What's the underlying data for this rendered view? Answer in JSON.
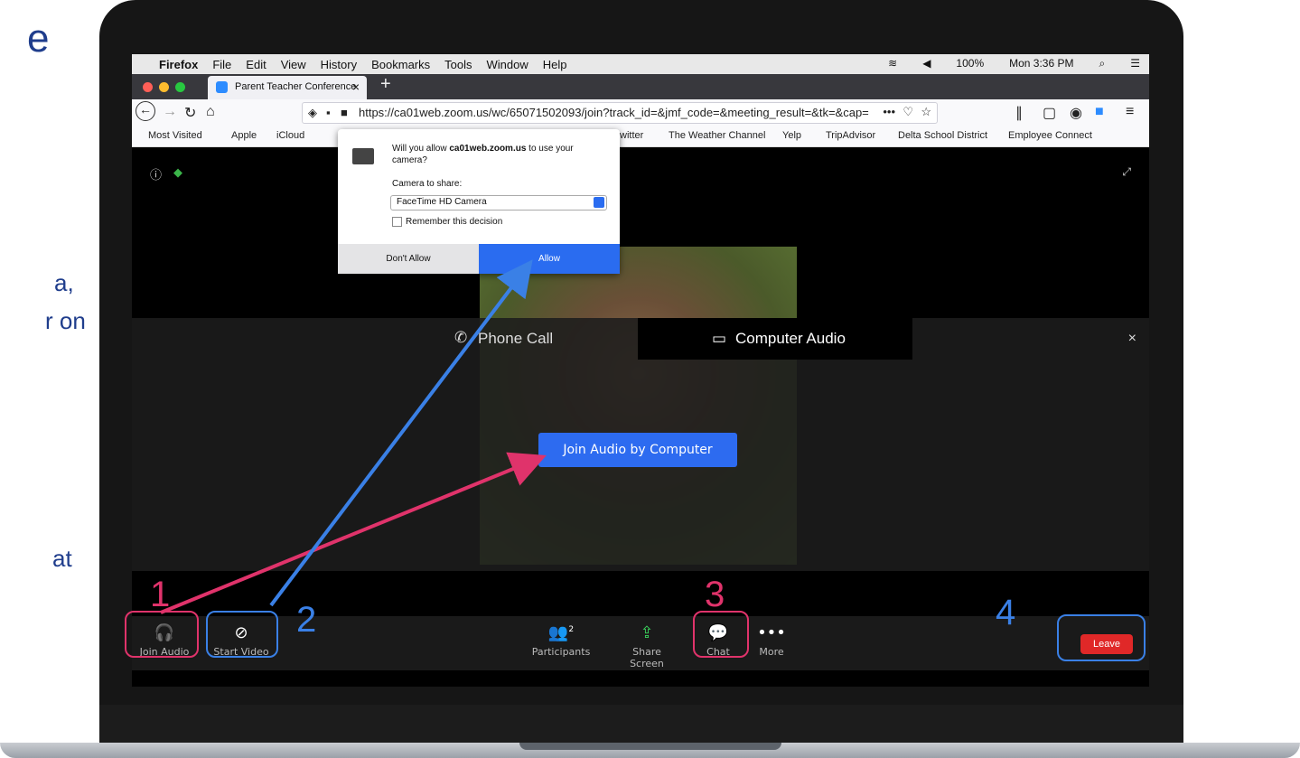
{
  "slide": {
    "text_fragments": [
      "e",
      "a,",
      "r on",
      "at"
    ]
  },
  "menubar": {
    "app": "Firefox",
    "items": [
      "File",
      "Edit",
      "View",
      "History",
      "Bookmarks",
      "Tools",
      "Window",
      "Help"
    ],
    "battery": "100%",
    "clock": "Mon 3:36 PM"
  },
  "browser": {
    "tab_title": "Parent Teacher Conference",
    "url": "https://ca01web.zoom.us/wc/65071502093/join?track_id=&jmf_code=&meeting_result=&tk=&cap=",
    "bookmarks": [
      "Most Visited",
      "Apple",
      "iCloud",
      "witter",
      "The Weather Channel",
      "Yelp",
      "TripAdvisor",
      "Delta School District",
      "Employee Connect"
    ]
  },
  "permission": {
    "question_prefix": "Will you allow ",
    "question_host": "ca01web.zoom.us",
    "question_suffix": " to use your camera?",
    "camera_label": "Camera to share:",
    "camera_value": "FaceTime HD Camera",
    "remember_label": "Remember this decision",
    "deny_label": "Don't Allow",
    "allow_label": "Allow"
  },
  "audio_panel": {
    "tab_phone": "Phone Call",
    "tab_computer": "Computer Audio",
    "join_button": "Join Audio by Computer"
  },
  "toolbar": {
    "join_audio": "Join Audio",
    "start_video": "Start Video",
    "participants": "Participants",
    "participants_count": "2",
    "share_screen": "Share Screen",
    "chat": "Chat",
    "more": "More",
    "leave": "Leave"
  },
  "callouts": {
    "n1": "1",
    "n2": "2",
    "n3": "3",
    "n4": "4",
    "pink": "#e0336b",
    "blue": "#3a80e6"
  },
  "colors": {
    "zoom_blue": "#2d6bf0",
    "leave_red": "#e02828"
  }
}
